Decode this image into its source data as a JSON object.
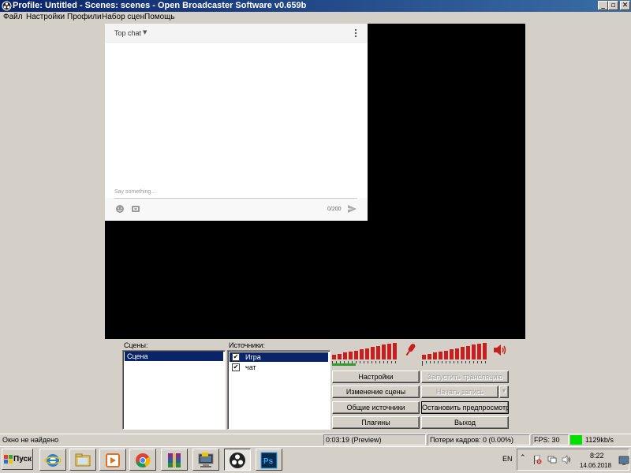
{
  "window": {
    "title": "Profile: Untitled - Scenes: scenes - Open Broadcaster Software v0.659b",
    "minimize_glyph": "_",
    "maximize_glyph": "▫",
    "close_glyph": "✕"
  },
  "menu": {
    "items": [
      "Файл",
      "Настройки",
      "Профили",
      "Набор сцен",
      "Помощь"
    ]
  },
  "chat": {
    "title": "Top chat",
    "caret": "▼",
    "placeholder": "Say something...",
    "counter": "0/200"
  },
  "scenes": {
    "label": "Сцены:",
    "items": [
      "Сцена"
    ]
  },
  "sources": {
    "label": "Источники:",
    "items": [
      {
        "name": "Игра",
        "checked": "✔"
      },
      {
        "name": "чат",
        "checked": "✔"
      }
    ]
  },
  "buttons": {
    "settings": "Настройки",
    "start_stream": "Запустить трансляцию",
    "edit_scene": "Изменение сцены",
    "start_record": "Начать запись",
    "record_dropdown": "▼",
    "global_sources": "Общие источники",
    "stop_preview": "Остановить предпросмотр",
    "plugins": "Плагины",
    "exit": "Выход"
  },
  "status": {
    "message": "Окно не найдено",
    "time": "0:03:19 (Preview)",
    "dropped_frames": "Потери кадров: 0 (0.00%)",
    "fps": "FPS: 30",
    "bitrate": "1129kb/s",
    "color_ok": "#00e000"
  },
  "taskbar": {
    "start_label": "Пуск",
    "apps": [
      "ie-icon",
      "explorer-icon",
      "media-player-icon",
      "chrome-icon",
      "winrar-icon",
      "computer-icon",
      "obs-icon",
      "photoshop-icon"
    ],
    "language": "EN",
    "time": "8:22",
    "date": "14.06.2018"
  },
  "colors": {
    "titlebar": "#0a246a",
    "selection": "#0a246a",
    "meter_red": "#c81e1e",
    "meter_green": "#2ea02e",
    "mic_icon": "#c81e1e"
  }
}
